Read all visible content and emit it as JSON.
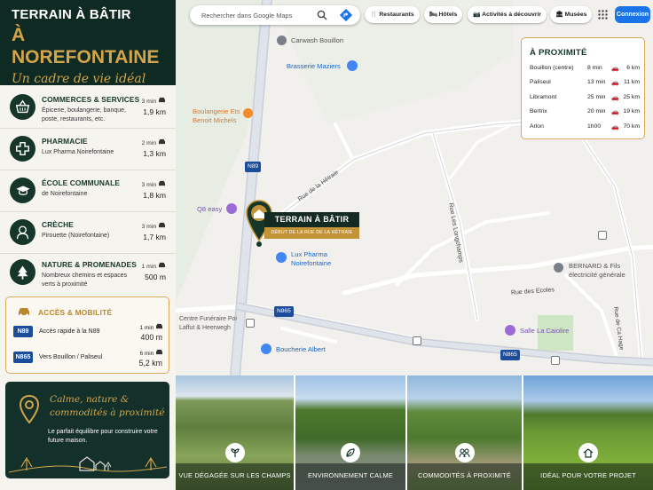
{
  "hero": {
    "line1": "TERRAIN À BÂTIR",
    "line2": "À NOREFONTAINE",
    "tagline": "Un cadre de vie idéal"
  },
  "amenities": [
    {
      "title": "COMMERCES & SERVICES",
      "desc": "Épicerie, boulangerie, banque, poste, restaurants, etc.",
      "time": "3 min",
      "dist": "1,9 km",
      "icon": "basket-icon"
    },
    {
      "title": "PHARMACIE",
      "desc": "Lux Pharma Noirefontaine",
      "time": "2 min",
      "dist": "1,3 km",
      "icon": "cross-icon"
    },
    {
      "title": "ÉCOLE COMMUNALE",
      "desc": "de Noirefontaine",
      "time": "3 min",
      "dist": "1,8 km",
      "icon": "graduation-cap-icon"
    },
    {
      "title": "CRÈCHE",
      "desc": "Pirouette (Noirefontaine)",
      "time": "3 min",
      "dist": "1,7 km",
      "icon": "child-icon"
    },
    {
      "title": "NATURE & PROMENADES",
      "desc": "Nombreux chemins et espaces verts à proximité",
      "time": "1 min",
      "dist": "500 m",
      "icon": "tree-icon"
    }
  ],
  "access": {
    "title": "ACCÈS & MOBILITÉ",
    "routes": [
      {
        "road": "N89",
        "label": "Accès rapide à la N89",
        "time": "1 min",
        "dist": "400 m"
      },
      {
        "road": "N865",
        "label": "Vers Bouillon / Paliseul",
        "time": "6 min",
        "dist": "5,2 km"
      }
    ]
  },
  "calm": {
    "title": "Calme, nature & commodités à proximité",
    "desc": "Le parfait équilibre pour construire votre future maison."
  },
  "map": {
    "search_placeholder": "Rechercher dans Google Maps",
    "chips": [
      "Restaurants",
      "Hôtels",
      "Activités à découvrir",
      "Musées"
    ],
    "login": "Connexion",
    "pois": {
      "carwash": "Carwash Bouillon",
      "brasserie": "Brasserie Maziers",
      "boulangerie": "Boulangerie Ets Benoit Michels",
      "q8": "Q8 easy",
      "pharma": "Lux Pharma Noirefontaine",
      "funeraire": "Centre Funéraire Poi Laffut & Heerwegh",
      "boucherie": "Boucherie Albert",
      "bernard": "BERNARD & Fils électricité générale",
      "salle": "Salle La Caiolire"
    },
    "streets": {
      "hetraie": "Rue de la Hêtraie",
      "longchamps": "Rue Les Longchamps",
      "ecoles": "Rue des Ecoles",
      "hage": "Rue de Ca Hage"
    },
    "road_labels": {
      "n89": "N89",
      "n865a": "N865",
      "n865b": "N865"
    },
    "terrain": {
      "title": "TERRAIN À BÂTIR",
      "subtitle": "DÉBUT DE LA RUE DE LA HÊTRAIE"
    }
  },
  "proximity": {
    "title": "À PROXIMITÉ",
    "rows": [
      {
        "place": "Bouillon (centre)",
        "time": "8 min",
        "dist": "6 km"
      },
      {
        "place": "Paliseul",
        "time": "13 min",
        "dist": "11 km"
      },
      {
        "place": "Libramont",
        "time": "25 min",
        "dist": "25 km"
      },
      {
        "place": "Bertrix",
        "time": "20 min",
        "dist": "19 km"
      },
      {
        "place": "Arlon",
        "time": "1h00",
        "dist": "70 km"
      }
    ]
  },
  "photos": [
    {
      "label": "VUE DÉGAGÉE SUR LES CHAMPS",
      "icon": "sprout-icon"
    },
    {
      "label": "ENVIRONNEMENT CALME",
      "icon": "leaf-icon"
    },
    {
      "label": "COMMODITÉS À PROXIMITÉ",
      "icon": "people-icon"
    },
    {
      "label": "IDÉAL POUR VOTRE PROJET",
      "icon": "house-icon"
    }
  ],
  "colors": {
    "dark_green": "#0f2a22",
    "gold": "#d4a54a",
    "road_blue": "#1c4d9a",
    "map_blue": "#1a73e8"
  }
}
